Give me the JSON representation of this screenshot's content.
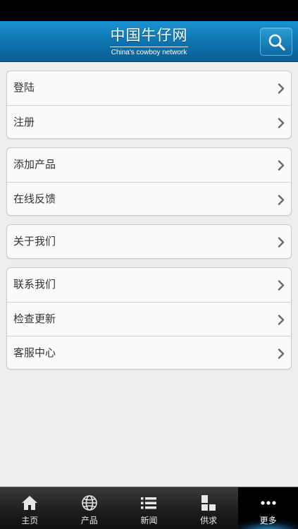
{
  "header": {
    "title": "中国牛仔网",
    "subtitle": "China's cowboy network"
  },
  "menu": {
    "groups": [
      {
        "items": [
          {
            "label": "登陆"
          },
          {
            "label": "注册"
          }
        ]
      },
      {
        "items": [
          {
            "label": "添加产品"
          },
          {
            "label": "在线反馈"
          }
        ]
      },
      {
        "items": [
          {
            "label": "关于我们"
          }
        ]
      },
      {
        "items": [
          {
            "label": "联系我们"
          },
          {
            "label": "检查更新"
          },
          {
            "label": "客服中心"
          }
        ]
      }
    ]
  },
  "tabbar": {
    "active_tab": "更多",
    "tabs": [
      {
        "label": "主页",
        "icon": "home-icon"
      },
      {
        "label": "产品",
        "icon": "globe-icon"
      },
      {
        "label": "新闻",
        "icon": "list-icon"
      },
      {
        "label": "供求",
        "icon": "blocks-icon"
      },
      {
        "label": "更多",
        "icon": "more-dots-icon"
      }
    ]
  },
  "colors": {
    "header_blue": "#0d72ad",
    "background": "#eeeeee",
    "tab_bar": "#1c1c1c",
    "active_glow": "#32aaf0"
  }
}
